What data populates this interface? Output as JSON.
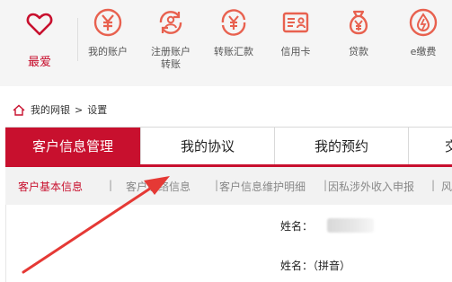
{
  "topnav": {
    "favorite": {
      "label": "最爱",
      "icon": "heart-icon"
    },
    "items": [
      {
        "label": "我的账户",
        "icon": "yen-circle-icon"
      },
      {
        "label": "注册账户",
        "label2": "转账",
        "icon": "account-refresh-icon"
      },
      {
        "label": "转账汇款",
        "icon": "yen-transfer-icon"
      },
      {
        "label": "信用卡",
        "icon": "credit-card-icon"
      },
      {
        "label": "贷款",
        "icon": "money-bag-icon"
      },
      {
        "label": "e缴费",
        "icon": "droplet-icon"
      }
    ]
  },
  "breadcrumb": {
    "home": "我的网银",
    "sep": ">",
    "current": "设置"
  },
  "tabs": [
    {
      "label": "客户信息管理",
      "active": true
    },
    {
      "label": "我的协议",
      "active": false
    },
    {
      "label": "我的预约",
      "active": false
    },
    {
      "label": "交",
      "active": false
    }
  ],
  "subnav": {
    "items": [
      "客户基本信息",
      "客户联络信息",
      "客户信息维护明细",
      "因私涉外收入申报",
      "风"
    ],
    "sep": "|"
  },
  "form": {
    "name_label": "姓名：",
    "pinyin_label": "姓名：（拼音）"
  },
  "colors": {
    "brand": "#c8102e",
    "annotation_arrow": "#e53935"
  }
}
